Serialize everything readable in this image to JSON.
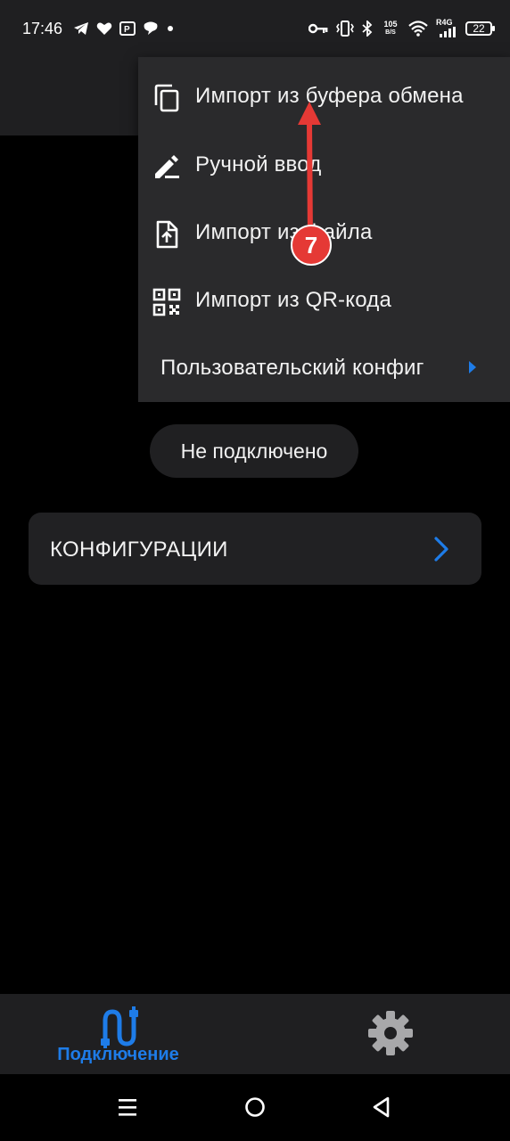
{
  "status_bar": {
    "time": "17:46",
    "net_speed_value": "105",
    "net_speed_unit": "B/S",
    "signal_label": "R4G",
    "battery": "22",
    "icons": [
      "telegram-icon",
      "heart-icon",
      "parking-app-icon",
      "chat-icon",
      "dot-icon",
      "vpn-key-icon",
      "vibrate-icon",
      "bluetooth-icon",
      "wifi-icon",
      "signal-icon",
      "battery-icon"
    ]
  },
  "menu": {
    "items": [
      {
        "label": "Импорт из буфера обмена",
        "icon": "copy-icon"
      },
      {
        "label": "Ручной ввод",
        "icon": "edit-pencil-icon"
      },
      {
        "label": "Импорт из файла",
        "icon": "file-upload-icon"
      },
      {
        "label": "Импорт из QR-кода",
        "icon": "qr-code-icon"
      },
      {
        "label": "Пользовательский конфиг",
        "icon": "submenu-arrow-icon"
      }
    ]
  },
  "connection_status": "Не подключено",
  "configurations": {
    "label": "КОНФИГУРАЦИИ",
    "icon": "chevron-right-icon"
  },
  "annotation": {
    "step_number": "7",
    "color": "#e53935"
  },
  "bottom_nav": {
    "tabs": [
      {
        "label": "Подключение",
        "icon": "connection-plug-icon",
        "active": true
      },
      {
        "label": "",
        "icon": "gear-icon",
        "active": false
      }
    ]
  },
  "system_nav": {
    "icons": [
      "recents-icon",
      "home-icon",
      "back-icon"
    ]
  },
  "colors": {
    "accent": "#1e7ce8",
    "background": "#000000",
    "surface": "#1f1f21",
    "menu_surface": "#2a2a2c"
  }
}
